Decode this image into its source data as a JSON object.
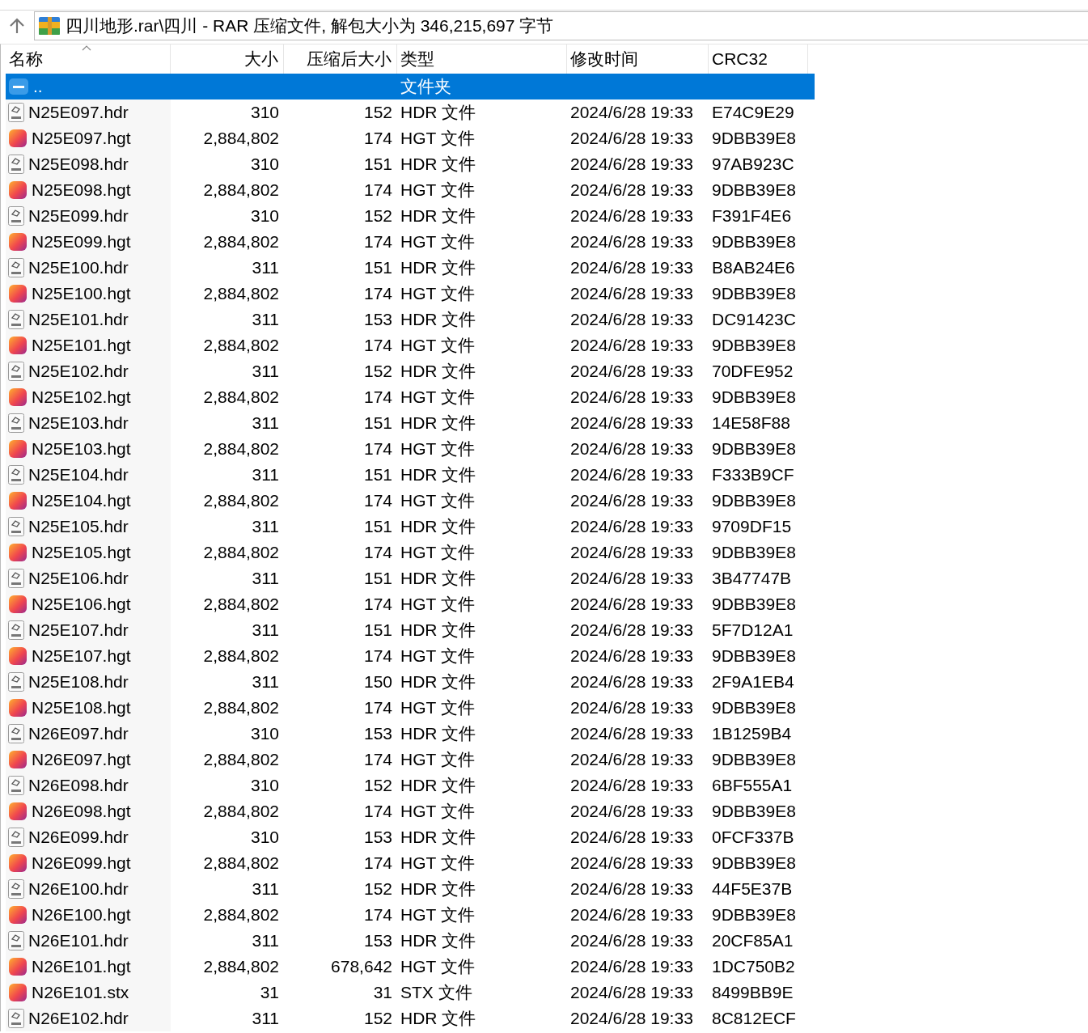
{
  "address_bar": {
    "path": "四川地形.rar\\四川 - RAR 压缩文件, 解包大小为 346,215,697 字节"
  },
  "columns": [
    {
      "label": "名称",
      "sorted": true
    },
    {
      "label": "大小",
      "sorted": false
    },
    {
      "label": "压缩后大小",
      "sorted": false
    },
    {
      "label": "类型",
      "sorted": false
    },
    {
      "label": "修改时间",
      "sorted": false
    },
    {
      "label": "CRC32",
      "sorted": false
    }
  ],
  "rows": [
    {
      "kind": "folder",
      "name": "..",
      "type": "文件夹",
      "selected": true
    },
    {
      "kind": "hdr",
      "name": "N25E097.hdr",
      "size": "310",
      "packed": "152",
      "type": "HDR 文件",
      "modified": "2024/6/28 19:33",
      "crc": "E74C9E29",
      "selected": false
    },
    {
      "kind": "hgt",
      "name": "N25E097.hgt",
      "size": "2,884,802",
      "packed": "174",
      "type": "HGT 文件",
      "modified": "2024/6/28 19:33",
      "crc": "9DBB39E8",
      "selected": false
    },
    {
      "kind": "hdr",
      "name": "N25E098.hdr",
      "size": "310",
      "packed": "151",
      "type": "HDR 文件",
      "modified": "2024/6/28 19:33",
      "crc": "97AB923C",
      "selected": false
    },
    {
      "kind": "hgt",
      "name": "N25E098.hgt",
      "size": "2,884,802",
      "packed": "174",
      "type": "HGT 文件",
      "modified": "2024/6/28 19:33",
      "crc": "9DBB39E8",
      "selected": false
    },
    {
      "kind": "hdr",
      "name": "N25E099.hdr",
      "size": "310",
      "packed": "152",
      "type": "HDR 文件",
      "modified": "2024/6/28 19:33",
      "crc": "F391F4E6",
      "selected": false
    },
    {
      "kind": "hgt",
      "name": "N25E099.hgt",
      "size": "2,884,802",
      "packed": "174",
      "type": "HGT 文件",
      "modified": "2024/6/28 19:33",
      "crc": "9DBB39E8",
      "selected": false
    },
    {
      "kind": "hdr",
      "name": "N25E100.hdr",
      "size": "311",
      "packed": "151",
      "type": "HDR 文件",
      "modified": "2024/6/28 19:33",
      "crc": "B8AB24E6",
      "selected": false
    },
    {
      "kind": "hgt",
      "name": "N25E100.hgt",
      "size": "2,884,802",
      "packed": "174",
      "type": "HGT 文件",
      "modified": "2024/6/28 19:33",
      "crc": "9DBB39E8",
      "selected": false
    },
    {
      "kind": "hdr",
      "name": "N25E101.hdr",
      "size": "311",
      "packed": "153",
      "type": "HDR 文件",
      "modified": "2024/6/28 19:33",
      "crc": "DC91423C",
      "selected": false
    },
    {
      "kind": "hgt",
      "name": "N25E101.hgt",
      "size": "2,884,802",
      "packed": "174",
      "type": "HGT 文件",
      "modified": "2024/6/28 19:33",
      "crc": "9DBB39E8",
      "selected": false
    },
    {
      "kind": "hdr",
      "name": "N25E102.hdr",
      "size": "311",
      "packed": "152",
      "type": "HDR 文件",
      "modified": "2024/6/28 19:33",
      "crc": "70DFE952",
      "selected": false
    },
    {
      "kind": "hgt",
      "name": "N25E102.hgt",
      "size": "2,884,802",
      "packed": "174",
      "type": "HGT 文件",
      "modified": "2024/6/28 19:33",
      "crc": "9DBB39E8",
      "selected": false
    },
    {
      "kind": "hdr",
      "name": "N25E103.hdr",
      "size": "311",
      "packed": "151",
      "type": "HDR 文件",
      "modified": "2024/6/28 19:33",
      "crc": "14E58F88",
      "selected": false
    },
    {
      "kind": "hgt",
      "name": "N25E103.hgt",
      "size": "2,884,802",
      "packed": "174",
      "type": "HGT 文件",
      "modified": "2024/6/28 19:33",
      "crc": "9DBB39E8",
      "selected": false
    },
    {
      "kind": "hdr",
      "name": "N25E104.hdr",
      "size": "311",
      "packed": "151",
      "type": "HDR 文件",
      "modified": "2024/6/28 19:33",
      "crc": "F333B9CF",
      "selected": false
    },
    {
      "kind": "hgt",
      "name": "N25E104.hgt",
      "size": "2,884,802",
      "packed": "174",
      "type": "HGT 文件",
      "modified": "2024/6/28 19:33",
      "crc": "9DBB39E8",
      "selected": false
    },
    {
      "kind": "hdr",
      "name": "N25E105.hdr",
      "size": "311",
      "packed": "151",
      "type": "HDR 文件",
      "modified": "2024/6/28 19:33",
      "crc": "9709DF15",
      "selected": false
    },
    {
      "kind": "hgt",
      "name": "N25E105.hgt",
      "size": "2,884,802",
      "packed": "174",
      "type": "HGT 文件",
      "modified": "2024/6/28 19:33",
      "crc": "9DBB39E8",
      "selected": false
    },
    {
      "kind": "hdr",
      "name": "N25E106.hdr",
      "size": "311",
      "packed": "151",
      "type": "HDR 文件",
      "modified": "2024/6/28 19:33",
      "crc": "3B47747B",
      "selected": false
    },
    {
      "kind": "hgt",
      "name": "N25E106.hgt",
      "size": "2,884,802",
      "packed": "174",
      "type": "HGT 文件",
      "modified": "2024/6/28 19:33",
      "crc": "9DBB39E8",
      "selected": false
    },
    {
      "kind": "hdr",
      "name": "N25E107.hdr",
      "size": "311",
      "packed": "151",
      "type": "HDR 文件",
      "modified": "2024/6/28 19:33",
      "crc": "5F7D12A1",
      "selected": false
    },
    {
      "kind": "hgt",
      "name": "N25E107.hgt",
      "size": "2,884,802",
      "packed": "174",
      "type": "HGT 文件",
      "modified": "2024/6/28 19:33",
      "crc": "9DBB39E8",
      "selected": false
    },
    {
      "kind": "hdr",
      "name": "N25E108.hdr",
      "size": "311",
      "packed": "150",
      "type": "HDR 文件",
      "modified": "2024/6/28 19:33",
      "crc": "2F9A1EB4",
      "selected": false
    },
    {
      "kind": "hgt",
      "name": "N25E108.hgt",
      "size": "2,884,802",
      "packed": "174",
      "type": "HGT 文件",
      "modified": "2024/6/28 19:33",
      "crc": "9DBB39E8",
      "selected": false
    },
    {
      "kind": "hdr",
      "name": "N26E097.hdr",
      "size": "310",
      "packed": "153",
      "type": "HDR 文件",
      "modified": "2024/6/28 19:33",
      "crc": "1B1259B4",
      "selected": false
    },
    {
      "kind": "hgt",
      "name": "N26E097.hgt",
      "size": "2,884,802",
      "packed": "174",
      "type": "HGT 文件",
      "modified": "2024/6/28 19:33",
      "crc": "9DBB39E8",
      "selected": false
    },
    {
      "kind": "hdr",
      "name": "N26E098.hdr",
      "size": "310",
      "packed": "152",
      "type": "HDR 文件",
      "modified": "2024/6/28 19:33",
      "crc": "6BF555A1",
      "selected": false
    },
    {
      "kind": "hgt",
      "name": "N26E098.hgt",
      "size": "2,884,802",
      "packed": "174",
      "type": "HGT 文件",
      "modified": "2024/6/28 19:33",
      "crc": "9DBB39E8",
      "selected": false
    },
    {
      "kind": "hdr",
      "name": "N26E099.hdr",
      "size": "310",
      "packed": "153",
      "type": "HDR 文件",
      "modified": "2024/6/28 19:33",
      "crc": "0FCF337B",
      "selected": false
    },
    {
      "kind": "hgt",
      "name": "N26E099.hgt",
      "size": "2,884,802",
      "packed": "174",
      "type": "HGT 文件",
      "modified": "2024/6/28 19:33",
      "crc": "9DBB39E8",
      "selected": false
    },
    {
      "kind": "hdr",
      "name": "N26E100.hdr",
      "size": "311",
      "packed": "152",
      "type": "HDR 文件",
      "modified": "2024/6/28 19:33",
      "crc": "44F5E37B",
      "selected": false
    },
    {
      "kind": "hgt",
      "name": "N26E100.hgt",
      "size": "2,884,802",
      "packed": "174",
      "type": "HGT 文件",
      "modified": "2024/6/28 19:33",
      "crc": "9DBB39E8",
      "selected": false
    },
    {
      "kind": "hdr",
      "name": "N26E101.hdr",
      "size": "311",
      "packed": "153",
      "type": "HDR 文件",
      "modified": "2024/6/28 19:33",
      "crc": "20CF85A1",
      "selected": false
    },
    {
      "kind": "hgt",
      "name": "N26E101.hgt",
      "size": "2,884,802",
      "packed": "678,642",
      "type": "HGT 文件",
      "modified": "2024/6/28 19:33",
      "crc": "1DC750B2",
      "selected": false
    },
    {
      "kind": "hgt",
      "name": "N26E101.stx",
      "size": "31",
      "packed": "31",
      "type": "STX 文件",
      "modified": "2024/6/28 19:33",
      "crc": "8499BB9E",
      "selected": false
    },
    {
      "kind": "hdr",
      "name": "N26E102.hdr",
      "size": "311",
      "packed": "152",
      "type": "HDR 文件",
      "modified": "2024/6/28 19:33",
      "crc": "8C812ECF",
      "selected": false
    }
  ]
}
